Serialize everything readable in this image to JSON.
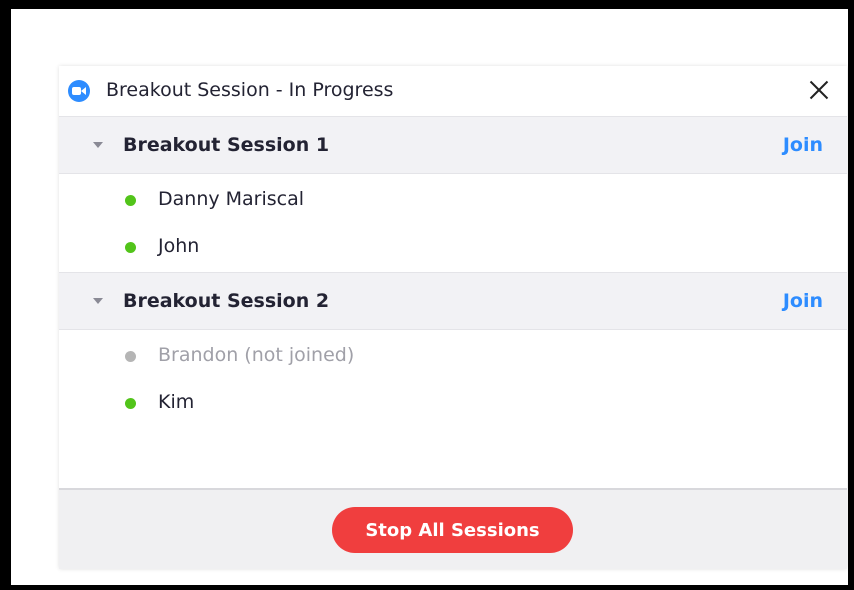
{
  "window": {
    "title": "Breakout Session - In Progress",
    "app_icon": "zoom-camera-icon",
    "close_icon": "close-icon"
  },
  "colors": {
    "accent": "#2d8cff",
    "stop_button": "#f03e3e",
    "status_joined": "#52c41a",
    "status_not_joined": "#b5b5b5",
    "text_primary": "#232333",
    "text_muted": "#a0a0a8"
  },
  "sessions": [
    {
      "name": "Breakout Session 1",
      "join_label": "Join",
      "participants": [
        {
          "name": "Danny Mariscal",
          "status": "joined"
        },
        {
          "name": "John",
          "status": "joined"
        }
      ]
    },
    {
      "name": "Breakout Session 2",
      "join_label": "Join",
      "participants": [
        {
          "name": "Brandon (not joined)",
          "status": "not_joined"
        },
        {
          "name": "Kim",
          "status": "joined"
        }
      ]
    }
  ],
  "footer": {
    "stop_label": "Stop All Sessions"
  }
}
